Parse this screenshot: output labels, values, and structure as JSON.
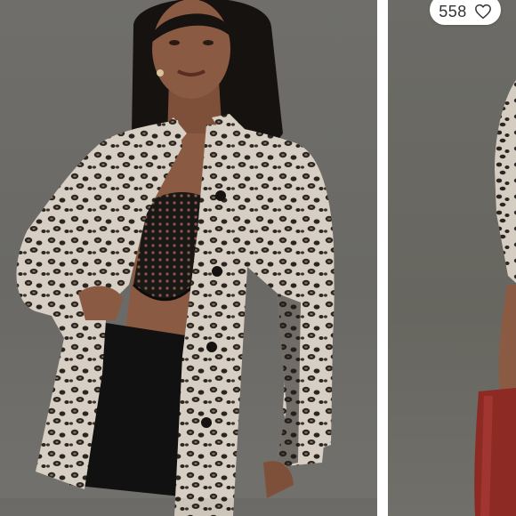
{
  "listing": {
    "likes": {
      "count": "558",
      "icon": "heart-outline-icon"
    },
    "photos": [
      {
        "subject": "leopard-print-coat-front"
      },
      {
        "subject": "leopard-print-coat-side"
      }
    ]
  },
  "colors": {
    "backdrop": "#6f6e6a",
    "leopard_base": "#d8cfc4",
    "leopard_spot": "#2a2521",
    "skirt": "#111111",
    "hair": "#161210",
    "skin": "#8a5a43",
    "boot": "#8e2a24"
  }
}
